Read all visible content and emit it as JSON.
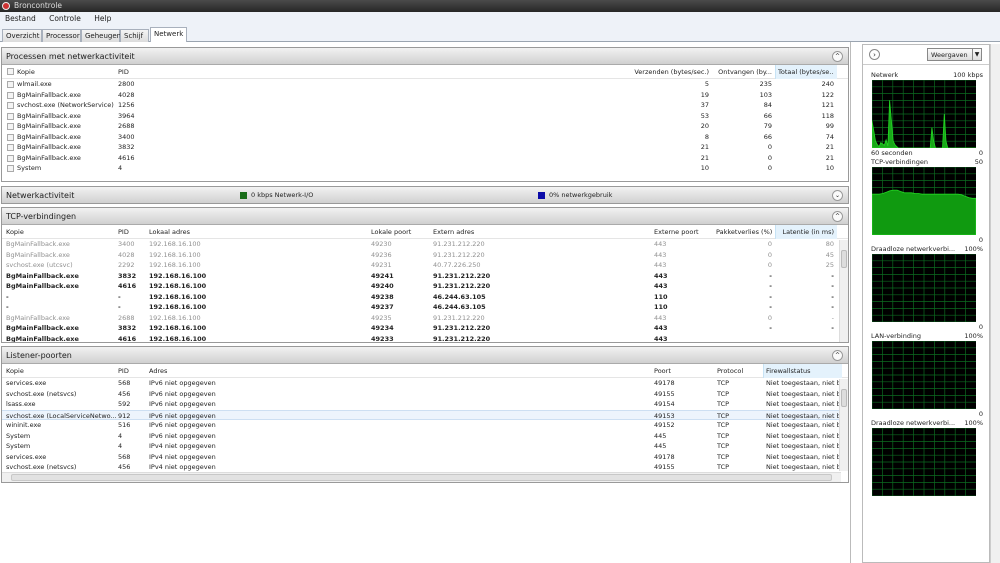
{
  "window": {
    "title": "Broncontrole"
  },
  "menu": [
    "Bestand",
    "Controle",
    "Help"
  ],
  "tabs": [
    "Overzicht",
    "Processor",
    "Geheugen",
    "Schijf",
    "Netwerk"
  ],
  "processes": {
    "title": "Processen met netwerkactiviteit",
    "columns": [
      "Kopie",
      "PID",
      "Verzenden (bytes/sec.)",
      "Ontvangen (by...",
      "Totaal (bytes/se..."
    ],
    "rows": [
      [
        "wlmail.exe",
        "2800",
        "5",
        "235",
        "240"
      ],
      [
        "BgMainFallback.exe",
        "4028",
        "19",
        "103",
        "122"
      ],
      [
        "svchost.exe (NetworkService)",
        "1256",
        "37",
        "84",
        "121"
      ],
      [
        "BgMainFallback.exe",
        "3964",
        "53",
        "66",
        "118"
      ],
      [
        "BgMainFallback.exe",
        "2688",
        "20",
        "79",
        "99"
      ],
      [
        "BgMainFallback.exe",
        "3400",
        "8",
        "66",
        "74"
      ],
      [
        "BgMainFallback.exe",
        "3832",
        "21",
        "0",
        "21"
      ],
      [
        "BgMainFallback.exe",
        "4616",
        "21",
        "0",
        "21"
      ],
      [
        "System",
        "4",
        "10",
        "0",
        "10"
      ]
    ]
  },
  "activity": {
    "title": "Netwerkactiviteit",
    "io_label": "0 kbps  Netwerk-I/O",
    "usage_label": "0% netwerkgebruik",
    "io_color": "#1a6e1a",
    "usage_color": "#0a0aa8"
  },
  "tcp": {
    "title": "TCP-verbindingen",
    "columns": [
      "Kopie",
      "PID",
      "Lokaal adres",
      "Lokale poort",
      "Extern adres",
      "Externe poort",
      "Pakketverlies (%)",
      "Latentie (in ms)"
    ],
    "rows": [
      {
        "style": "dim",
        "cells": [
          "BgMainFallback.exe",
          "3400",
          "192.168.16.100",
          "49230",
          "91.231.212.220",
          "443",
          "0",
          "80"
        ]
      },
      {
        "style": "dim",
        "cells": [
          "BgMainFallback.exe",
          "4028",
          "192.168.16.100",
          "49236",
          "91.231.212.220",
          "443",
          "0",
          "45"
        ]
      },
      {
        "style": "dim",
        "cells": [
          "svchost.exe (utcsvc)",
          "2292",
          "192.168.16.100",
          "49231",
          "40.77.226.250",
          "443",
          "0",
          "25"
        ]
      },
      {
        "style": "bold",
        "cells": [
          "BgMainFallback.exe",
          "3832",
          "192.168.16.100",
          "49241",
          "91.231.212.220",
          "443",
          "-",
          "-"
        ]
      },
      {
        "style": "bold",
        "cells": [
          "BgMainFallback.exe",
          "4616",
          "192.168.16.100",
          "49240",
          "91.231.212.220",
          "443",
          "-",
          "-"
        ]
      },
      {
        "style": "bold",
        "cells": [
          "-",
          "-",
          "192.168.16.100",
          "49238",
          "46.244.63.105",
          "110",
          "-",
          "-"
        ]
      },
      {
        "style": "bold",
        "cells": [
          "-",
          "-",
          "192.168.16.100",
          "49237",
          "46.244.63.105",
          "110",
          "-",
          "-"
        ]
      },
      {
        "style": "dim",
        "cells": [
          "BgMainFallback.exe",
          "2688",
          "192.168.16.100",
          "49235",
          "91.231.212.220",
          "443",
          "0",
          "-"
        ]
      },
      {
        "style": "bold",
        "cells": [
          "BgMainFallback.exe",
          "3832",
          "192.168.16.100",
          "49234",
          "91.231.212.220",
          "443",
          "-",
          "-"
        ]
      },
      {
        "style": "bold",
        "cells": [
          "BgMainFallback.exe",
          "4616",
          "192.168.16.100",
          "49233",
          "91.231.212.220",
          "443",
          "",
          ""
        ]
      }
    ]
  },
  "listeners": {
    "title": "Listener-poorten",
    "columns": [
      "Kopie",
      "PID",
      "Adres",
      "Poort",
      "Protocol",
      "Firewallstatus"
    ],
    "rows": [
      [
        "services.exe",
        "568",
        "IPv6 niet opgegeven",
        "49178",
        "TCP",
        "Niet toegestaan, niet b"
      ],
      [
        "svchost.exe (netsvcs)",
        "456",
        "IPv6 niet opgegeven",
        "49155",
        "TCP",
        "Niet toegestaan, niet b"
      ],
      [
        "lsass.exe",
        "592",
        "IPv6 niet opgegeven",
        "49154",
        "TCP",
        "Niet toegestaan, niet b"
      ],
      [
        "svchost.exe (LocalServiceNetwo...",
        "912",
        "IPv6 niet opgegeven",
        "49153",
        "TCP",
        "Niet toegestaan, niet b"
      ],
      [
        "wininit.exe",
        "516",
        "IPv6 niet opgegeven",
        "49152",
        "TCP",
        "Niet toegestaan, niet b"
      ],
      [
        "System",
        "4",
        "IPv6 niet opgegeven",
        "445",
        "TCP",
        "Niet toegestaan, niet b"
      ],
      [
        "System",
        "4",
        "IPv4 niet opgegeven",
        "445",
        "TCP",
        "Niet toegestaan, niet b"
      ],
      [
        "services.exe",
        "568",
        "IPv4 niet opgegeven",
        "49178",
        "TCP",
        "Niet toegestaan, niet b"
      ],
      [
        "svchost.exe (netsvcs)",
        "456",
        "IPv4 niet opgegeven",
        "49155",
        "TCP",
        "Niet toegestaan, niet b"
      ]
    ],
    "selected_index": 3
  },
  "side": {
    "view_button": "Weergaven",
    "graphs": [
      {
        "title": "Netwerk",
        "max": "100 kbps",
        "footer_left": "60 seconden",
        "footer_right": "0",
        "color": "#22d822",
        "type": "spikes",
        "values": [
          40,
          25,
          10,
          5,
          2,
          8,
          6,
          4,
          12,
          3,
          70,
          40,
          10,
          5,
          2,
          0,
          0,
          0,
          0,
          0,
          0,
          0,
          0,
          0,
          0,
          0,
          0,
          0,
          0,
          0,
          0,
          0,
          0,
          0,
          30,
          10,
          0,
          0,
          0,
          0,
          0,
          50,
          10,
          0,
          0,
          0,
          0,
          0,
          0,
          0,
          0,
          0,
          0,
          0,
          0,
          0,
          0,
          0,
          0,
          0
        ]
      },
      {
        "title": "TCP-verbindingen",
        "max": "50",
        "footer_left": "",
        "footer_right": "0",
        "color": "#22d822",
        "type": "area",
        "values": [
          60,
          60,
          60,
          61,
          63,
          65,
          66,
          66,
          64,
          62,
          62,
          62,
          61,
          61,
          60,
          60,
          60,
          60,
          60,
          60,
          60,
          60,
          60,
          60,
          60,
          59,
          57,
          55,
          54,
          54
        ]
      },
      {
        "title": "Draadloze netwerkverbi...",
        "max": "100%",
        "footer_left": "",
        "footer_right": "0",
        "color": "#22d822",
        "type": "flat",
        "values": []
      },
      {
        "title": "LAN-verbinding",
        "max": "100%",
        "footer_left": "",
        "footer_right": "0",
        "color": "#22d822",
        "type": "flat",
        "values": []
      },
      {
        "title": "Draadloze netwerkverbi...",
        "max": "100%",
        "footer_left": "",
        "footer_right": "",
        "color": "#22d822",
        "type": "flat",
        "values": []
      }
    ]
  }
}
